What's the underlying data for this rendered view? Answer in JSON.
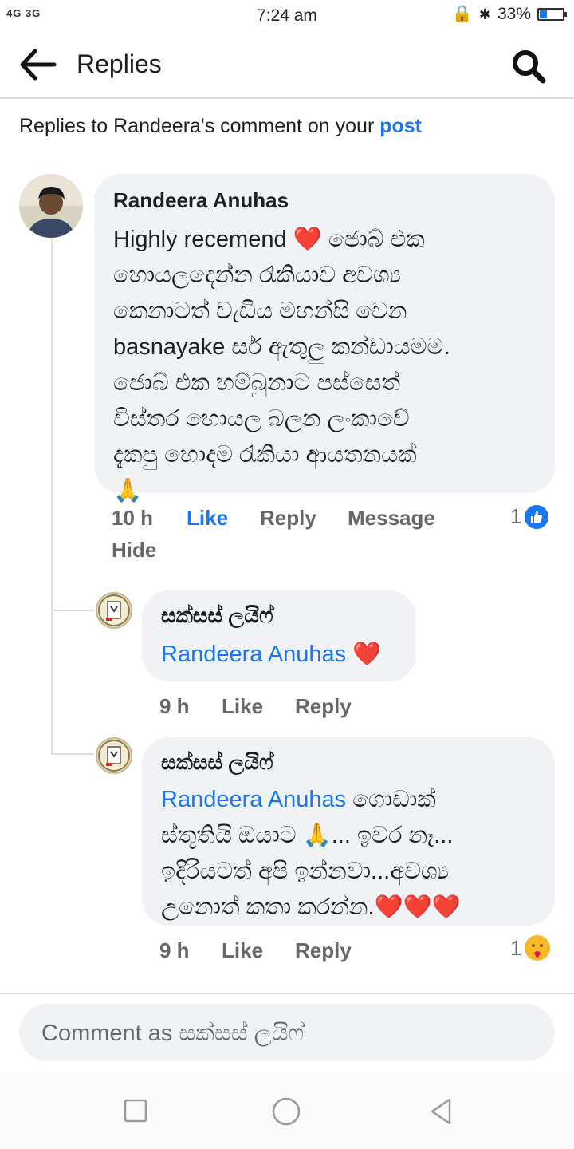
{
  "status_bar": {
    "network": "4G 3G",
    "time": "7:24 am",
    "battery": "33%",
    "battery_level": 0.33
  },
  "header": {
    "title": "Replies"
  },
  "subhead": {
    "prefix": "Replies to Randeera's comment on your ",
    "link": "post"
  },
  "comments": [
    {
      "author": "Randeera Anuhas",
      "lines": [
        "Highly recemend ❤️ ජොබ් එක",
        "හොයලදෙන්න රැකියාව අවශ්‍ය",
        "කෙනාටත් වැඩිය මහන්සි වෙන",
        "basnayake සර් ඇතුලු කන්ඩායමම.",
        "ජොබ් එක හම්බුනාට පස්සෙත්",
        "විස්තර හොයල බලන ලංකාවේ",
        "දැකපු හොදම රැකියා ආයතනයක්",
        "🙏"
      ],
      "time": "10 h",
      "like": "Like",
      "reply": "Reply",
      "message": "Message",
      "hide": "Hide",
      "reactions": "1"
    },
    {
      "author": "සක්සස් ලයිෆ්",
      "mention": "Randeera Anuhas",
      "lines": [
        "❤️"
      ],
      "time": "9 h",
      "like": "Like",
      "reply": "Reply"
    },
    {
      "author": "සක්සස් ලයිෆ්",
      "mention": "Randeera Anuhas",
      "lines": [
        " ගොඩාක්",
        "ස්තූතියි ඔයාට 🙏... ඉවර නෑ...",
        "ඉදිරියටත් අපි ඉන්නවා...අවශ්‍ය",
        "උනොත් කතා කරන්න.❤️❤️❤️"
      ],
      "time": "9 h",
      "like": "Like",
      "reply": "Reply",
      "reactions": "1"
    }
  ],
  "composer": {
    "placeholder": "Comment as සක්සස් ලයිෆ්"
  },
  "icons": {
    "back": "arrow-left-icon",
    "search": "search-icon",
    "like": "like-reaction-icon",
    "care": "care-reaction-icon"
  },
  "colors": {
    "accent": "#1877f2",
    "bubble": "#f0f2f5",
    "muted": "#65676b"
  }
}
